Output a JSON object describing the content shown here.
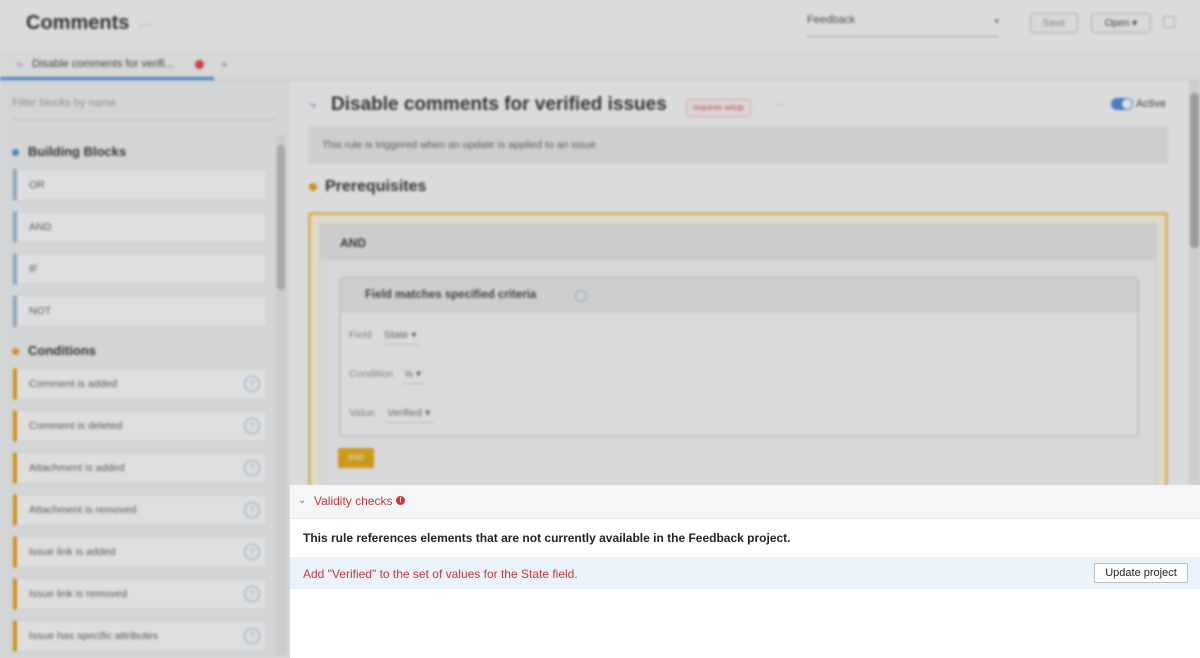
{
  "header": {
    "title": "Comments",
    "more": "···",
    "project": "Feedback",
    "save_label": "Save",
    "open_label": "Open ▾"
  },
  "tabs": [
    {
      "label": "Disable comments for verifi...",
      "icon": "rule-icon",
      "unsaved": true
    }
  ],
  "sidebar": {
    "filter_placeholder": "Filter blocks by name",
    "sections": [
      {
        "title": "Building Blocks",
        "color": "#3d8bd4"
      },
      {
        "title": "Conditions",
        "color": "#e69a00"
      }
    ],
    "building_blocks": [
      "OR",
      "AND",
      "IF",
      "NOT"
    ],
    "conditions": [
      "Comment is added",
      "Comment is deleted",
      "Attachment is added",
      "Attachment is removed",
      "Issue link is added",
      "Issue link is removed",
      "Issue has specific attributes"
    ]
  },
  "rule": {
    "title": "Disable comments for verified issues",
    "badge": "requires setup",
    "more": "···",
    "active_label": "Active",
    "trigger": "This rule is triggered when an update is applied to an issue",
    "prereq_title": "Prerequisites",
    "and_label": "AND",
    "criteria_title": "Field matches specified criteria",
    "fields": [
      {
        "label": "Field",
        "value": "State ▾"
      },
      {
        "label": "Condition",
        "value": "is ▾"
      },
      {
        "label": "Value",
        "value": "Verified ▾"
      }
    ],
    "mini_and": "AND"
  },
  "validity": {
    "title": "Validity checks",
    "alert": "!",
    "message": "This rule references elements that are not currently available in the Feedback project.",
    "item": "Add \"Verified\" to the set of values for the State field.",
    "button": "Update project"
  },
  "colors": {
    "accent": "#3d8bd4",
    "error": "#c2383a",
    "warning": "#e69a00"
  }
}
